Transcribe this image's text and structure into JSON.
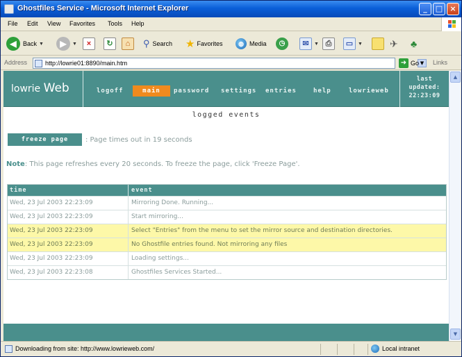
{
  "window": {
    "title": "Ghostfiles Service - Microsoft Internet Explorer",
    "controls": {
      "minimize": "_",
      "maximize": "□",
      "close": "×"
    }
  },
  "menubar": {
    "items": [
      "File",
      "Edit",
      "View",
      "Favorites",
      "Tools",
      "Help"
    ]
  },
  "toolbar": {
    "back_label": "Back",
    "search_label": "Search",
    "favorites_label": "Favorites",
    "media_label": "Media"
  },
  "addressbar": {
    "label": "Address",
    "url": "http://lowrie01:8890/main.htm",
    "go_label": "Go",
    "links_label": "Links"
  },
  "site": {
    "brand_prefix": "lowrie",
    "brand_suffix": "Web",
    "nav": [
      {
        "label": "logoff",
        "active": false
      },
      {
        "label": "main",
        "active": true
      },
      {
        "label": "password",
        "active": false
      },
      {
        "label": "settings",
        "active": false
      },
      {
        "label": "entries",
        "active": false
      },
      {
        "label": "help",
        "active": false
      },
      {
        "label": "lowrieweb",
        "active": false
      }
    ],
    "last_updated_label_1": "last",
    "last_updated_label_2": "updated:",
    "last_updated_time": "22:23:09",
    "accent_color": "#4a8f8c",
    "active_color": "#f08a1e"
  },
  "page": {
    "heading": "logged events",
    "freeze_button": "freeze page",
    "timeout_text": ": Page times out in 19 seconds",
    "note_label": "Note",
    "note_text": ": This page refreshes every 20 seconds. To freeze the page, click 'Freeze Page'."
  },
  "log": {
    "columns": [
      "time",
      "event"
    ],
    "rows": [
      {
        "time": "Wed, 23 Jul 2003 22:23:09",
        "event": "Mirroring Done. Running...",
        "highlight": false
      },
      {
        "time": "Wed, 23 Jul 2003 22:23:09",
        "event": "Start mirroring...",
        "highlight": false
      },
      {
        "time": "Wed, 23 Jul 2003 22:23:09",
        "event": "Select \"Entries\" from the menu to set the mirror source and destination directories.",
        "highlight": true
      },
      {
        "time": "Wed, 23 Jul 2003 22:23:09",
        "event": "No Ghostfile entries found. Not mirroring any files",
        "highlight": true
      },
      {
        "time": "Wed, 23 Jul 2003 22:23:09",
        "event": "Loading settings...",
        "highlight": false
      },
      {
        "time": "Wed, 23 Jul 2003 22:23:08",
        "event": "Ghostfiles Services Started...",
        "highlight": false
      }
    ],
    "highlight_color": "#fdf8a8"
  },
  "statusbar": {
    "text": "Downloading from site: http://www.lowrieweb.com/",
    "zone": "Local intranet"
  }
}
